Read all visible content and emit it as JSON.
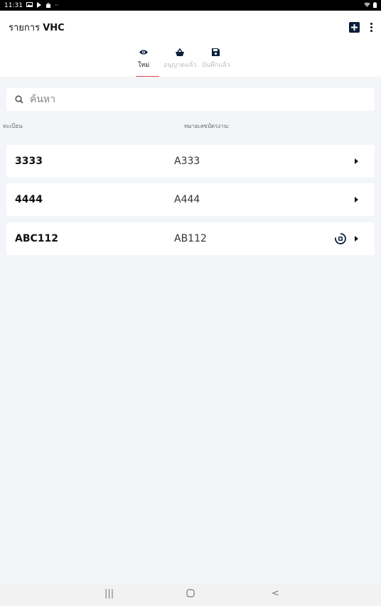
{
  "status_bar": {
    "time": "11:31",
    "icons": [
      "image-icon",
      "play-icon",
      "shopping-icon",
      "more-icon"
    ],
    "right_icons": [
      "wifi-icon",
      "battery-icon"
    ]
  },
  "app_bar": {
    "title_prefix": "รายการ ",
    "title_bold": "VHC",
    "actions": [
      "add-box-icon",
      "more-vert-icon"
    ]
  },
  "tabs": [
    {
      "label": "ใหม่",
      "icon": "eye-icon",
      "active": true
    },
    {
      "label": "อนุญาตแล้ว",
      "icon": "basket-icon",
      "active": false
    },
    {
      "label": "บันทึกแล้ว",
      "icon": "save-icon",
      "active": false
    }
  ],
  "search": {
    "placeholder": "ค้นหา"
  },
  "columns": {
    "registration": "ทะเบียน",
    "job_number": "หมายเลขบัตรงาน:"
  },
  "rows": [
    {
      "registration": "3333",
      "job_number": "A333",
      "status_icon": false
    },
    {
      "registration": "4444",
      "job_number": "A444",
      "status_icon": false
    },
    {
      "registration": "ABC112",
      "job_number": "AB112",
      "status_icon": true
    }
  ],
  "nav": {
    "recent": "|||",
    "home": "○",
    "back": "<"
  },
  "colors": {
    "accent": "#e0444e",
    "primary": "#0b1f3a",
    "background": "#f3f5f8"
  }
}
